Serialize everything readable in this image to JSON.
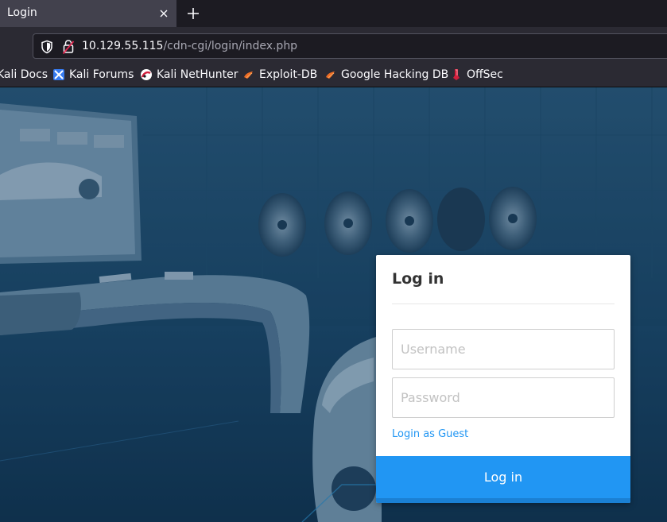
{
  "browser": {
    "tab": {
      "title": "Login"
    },
    "url": {
      "host": "10.129.55.115",
      "path": "/cdn-cgi/login/index.php"
    },
    "bookmarks": [
      {
        "label": "Kali Docs"
      },
      {
        "label": "Kali Forums"
      },
      {
        "label": "Kali NetHunter"
      },
      {
        "label": "Exploit-DB"
      },
      {
        "label": "Google Hacking DB"
      },
      {
        "label": "OffSec"
      }
    ]
  },
  "login": {
    "title": "Log in",
    "username_placeholder": "Username",
    "password_placeholder": "Password",
    "guest_link": "Login as Guest",
    "submit_label": "Log in"
  },
  "colors": {
    "accent": "#2196f3",
    "page_overlay": "#17405e",
    "toolbar": "#2b2a33"
  }
}
